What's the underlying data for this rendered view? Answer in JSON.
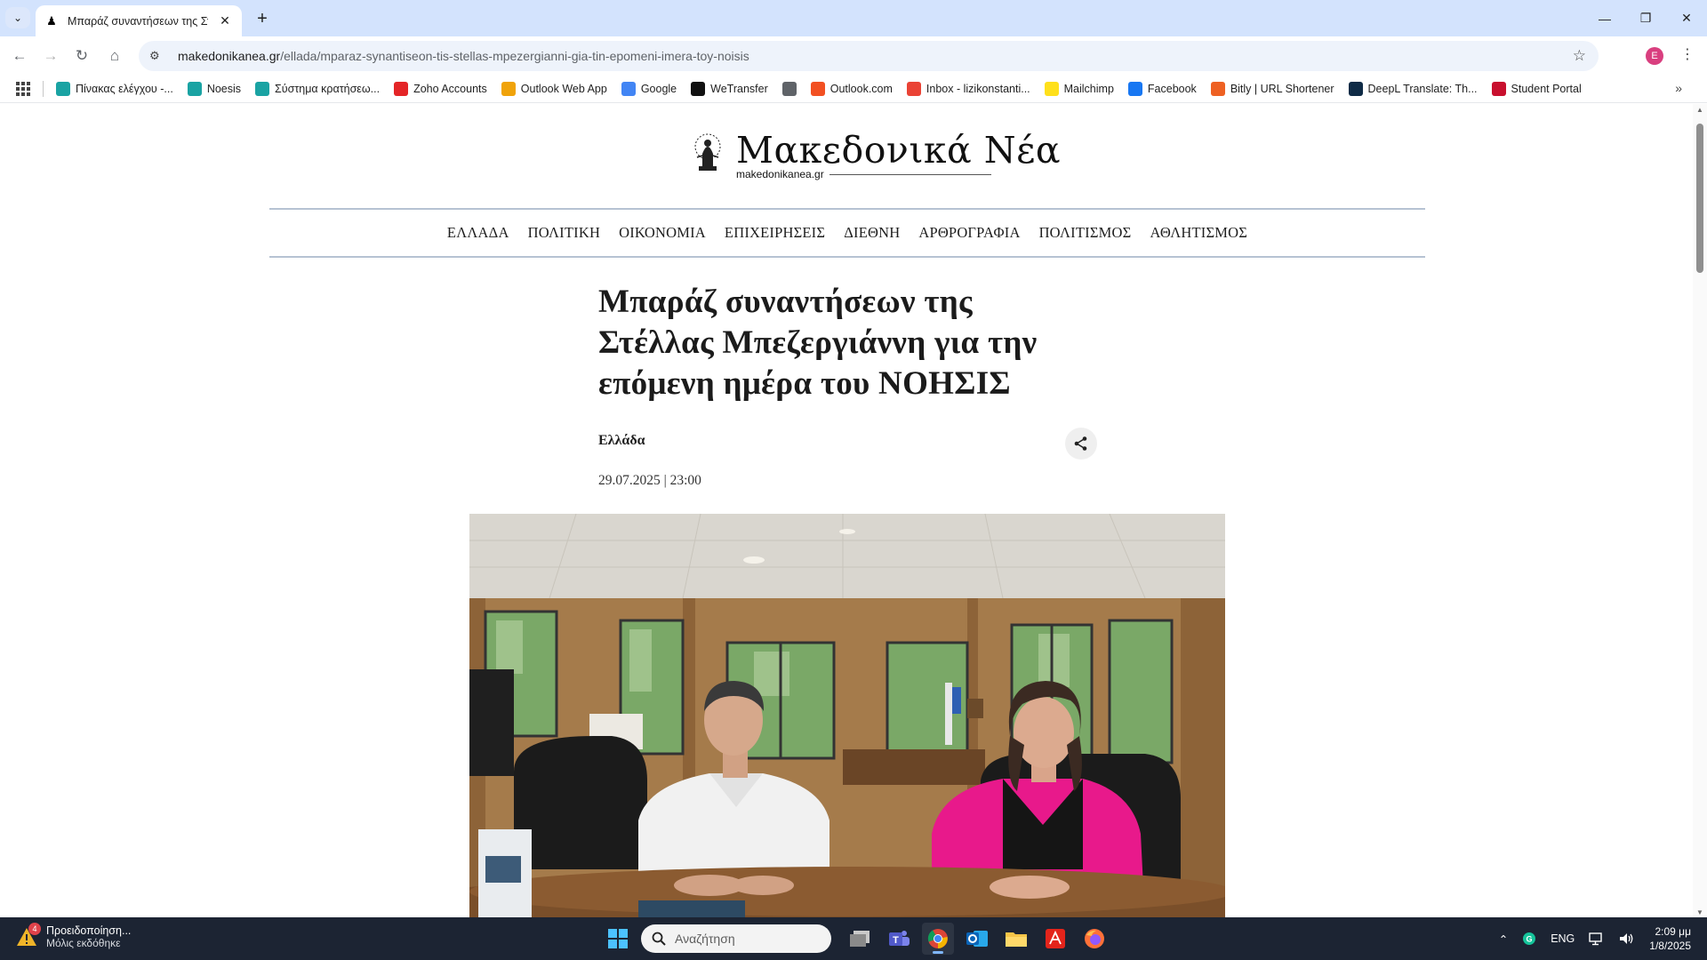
{
  "browser": {
    "tab_title": "Μπαράζ συναντήσεων της Στέλλας",
    "url_host": "makedonikanea.gr",
    "url_path": "/ellada/mparaz-synantiseon-tis-stellas-mpezergianni-gia-tin-epomeni-imera-toy-noisis",
    "profile_initial": "E"
  },
  "bookmarks": [
    {
      "label": "Πίνακας ελέγχου -...",
      "icon": "dashboard-icon",
      "color": "#1aa3a3"
    },
    {
      "label": "Noesis",
      "icon": "noesis-icon",
      "color": "#1aa3a3"
    },
    {
      "label": "Σύστημα κρατήσεω...",
      "icon": "booking-icon",
      "color": "#1aa3a3"
    },
    {
      "label": "Zoho Accounts",
      "icon": "zoho-icon",
      "color": "#e42527"
    },
    {
      "label": "Outlook Web App",
      "icon": "outlook-icon",
      "color": "#f0a30a"
    },
    {
      "label": "Google",
      "icon": "google-icon",
      "color": "#4285f4"
    },
    {
      "label": "WeTransfer",
      "icon": "wetransfer-icon",
      "color": "#111111"
    },
    {
      "label": "",
      "icon": "globe-icon",
      "color": "#5f6368"
    },
    {
      "label": "Outlook.com",
      "icon": "microsoft-icon",
      "color": "#f25022"
    },
    {
      "label": "Inbox - lizikonstanti...",
      "icon": "gmail-icon",
      "color": "#ea4335"
    },
    {
      "label": "Mailchimp",
      "icon": "mailchimp-icon",
      "color": "#ffe01b"
    },
    {
      "label": "Facebook",
      "icon": "facebook-icon",
      "color": "#1877f2"
    },
    {
      "label": "Bitly | URL Shortener",
      "icon": "bitly-icon",
      "color": "#ee6123"
    },
    {
      "label": "DeepL Translate: Th...",
      "icon": "deepl-icon",
      "color": "#0f2b46"
    },
    {
      "label": "Student Portal",
      "icon": "student-portal-icon",
      "color": "#c8102e"
    }
  ],
  "site": {
    "logo_title": "Μακεδονικά Νέα",
    "logo_sub": "makedonikanea.gr",
    "nav": [
      "ΕΛΛΑΔΑ",
      "ΠΟΛΙΤΙΚΗ",
      "ΟΙΚΟΝΟΜΙΑ",
      "ΕΠΙΧΕΙΡΗΣΕΙΣ",
      "ΔΙΕΘΝΗ",
      "ΑΡΘΡΟΓΡΑΦΙΑ",
      "ΠΟΛΙΤΙΣΜΟΣ",
      "ΑΘΛΗΤΙΣΜΟΣ"
    ]
  },
  "article": {
    "headline": "Μπαράζ συναντήσεων της Στέλλας Μπεζεργιάννη για την επόμενη ημέρα του ΝΟΗΣΙΣ",
    "category": "Ελλάδα",
    "date": "29.07.2025 | 23:00"
  },
  "taskbar": {
    "notif_title": "Προειδοποίηση...",
    "notif_sub": "Μόλις εκδόθηκε",
    "notif_badge": "4",
    "search_placeholder": "Αναζήτηση",
    "lang": "ENG",
    "time": "2:09 μμ",
    "date": "1/8/2025"
  },
  "colors": {
    "tabstrip": "#d3e3fd",
    "nav_border": "#b6c2d3",
    "taskbar": "#1c2433",
    "accent_pink": "#e8198b"
  }
}
